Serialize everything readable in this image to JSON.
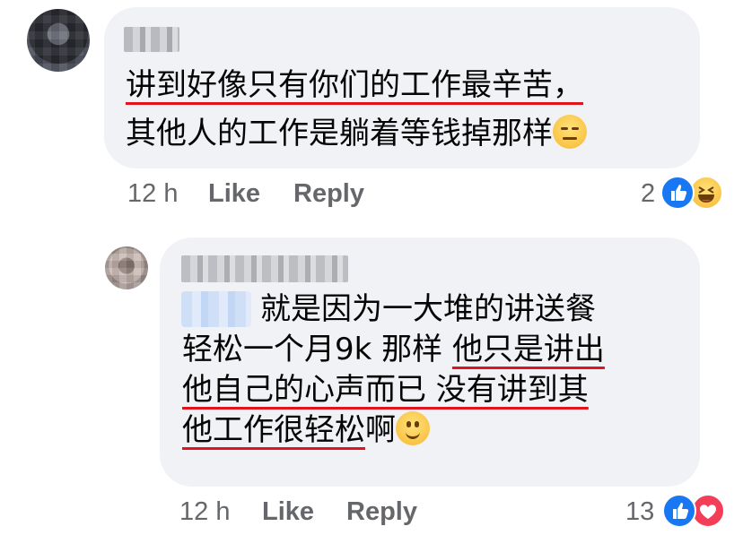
{
  "comments": [
    {
      "text": "讲到好像只有你们的工作最辛苦，",
      "text_line2": "其他人的工作是躺着等钱掉那样",
      "time": "12 h",
      "like_label": "Like",
      "reply_label": "Reply",
      "reaction_count": "2",
      "reactions": [
        "like-icon",
        "haha-icon"
      ],
      "emoji": "expressionless-face-icon"
    },
    {
      "text_line1": "就是因为一大堆的讲送餐",
      "text_line2_plain": "轻松一个月9k 那样 ",
      "text_line2_ul": "他只是讲出",
      "text_line3": "他自己的心声而已 没有讲到其",
      "text_line4": "他工作很轻松",
      "text_line4_tail": "啊",
      "time": "12 h",
      "like_label": "Like",
      "reply_label": "Reply",
      "reaction_count": "13",
      "reactions": [
        "like-icon",
        "love-icon"
      ],
      "emoji": "smiling-face-icon"
    }
  ],
  "colors": {
    "bubble": "#f0f2f5",
    "meta_text": "#65676b",
    "underline": "#e0141e",
    "like": "#1877f2",
    "love": "#f33e58"
  }
}
